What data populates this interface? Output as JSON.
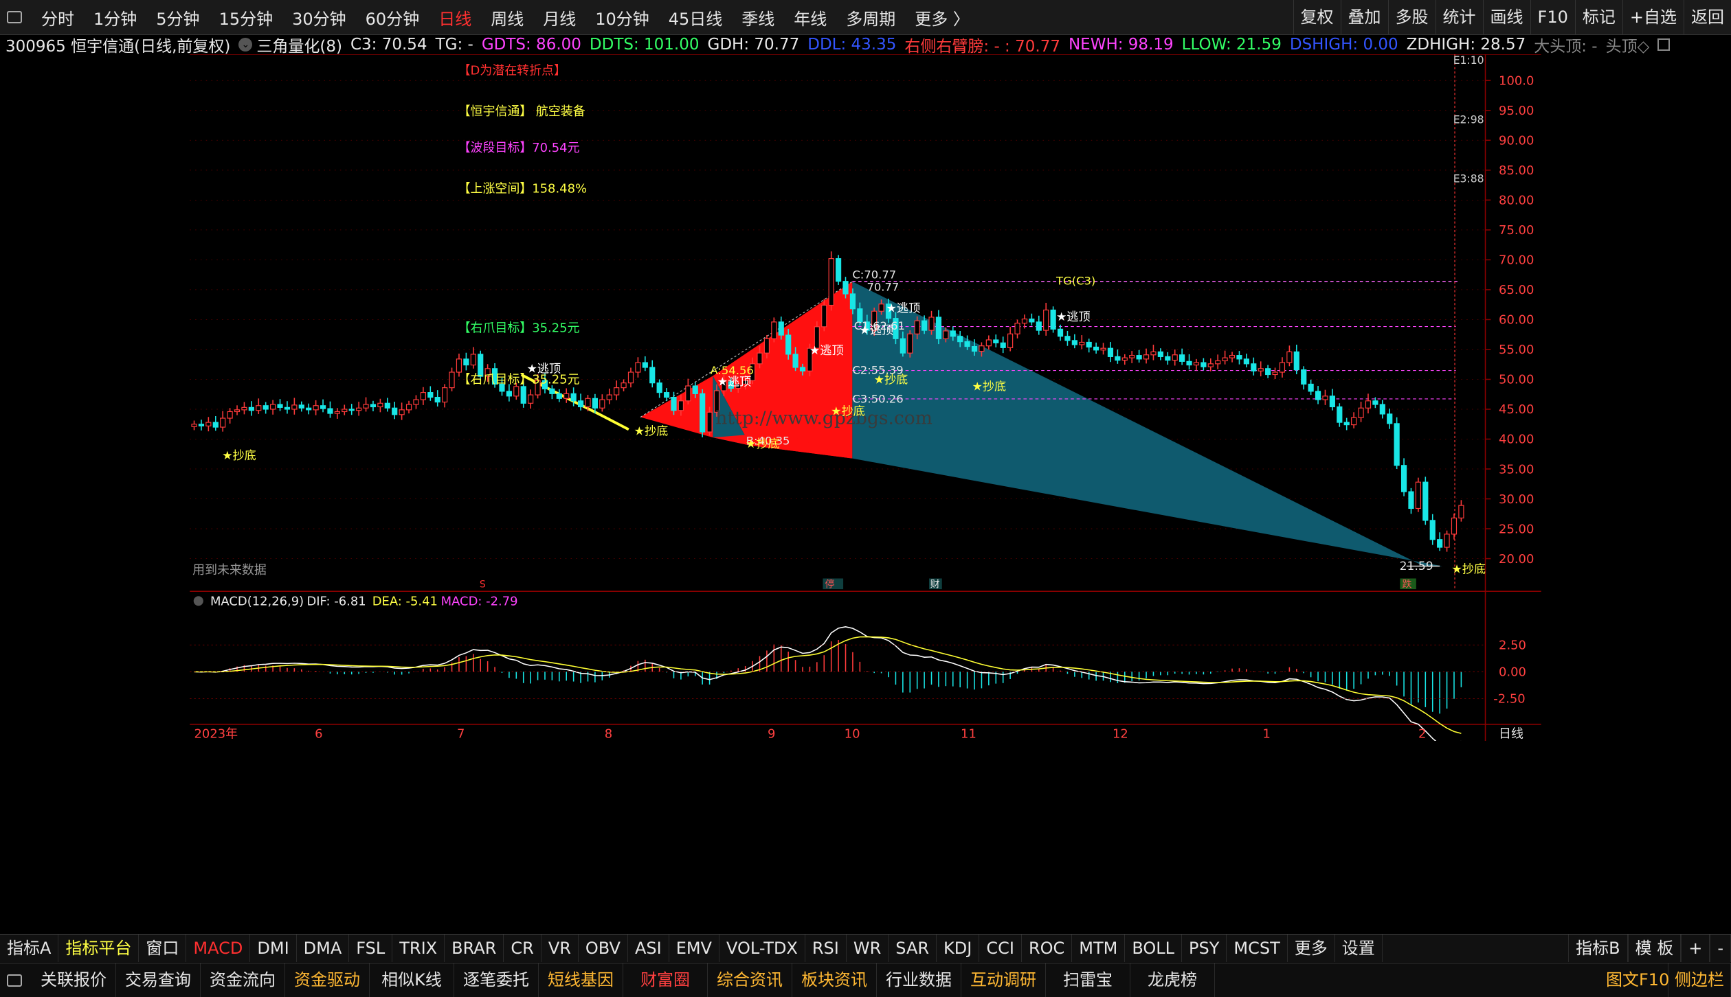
{
  "colors": {
    "up": "#ff3b3b",
    "down": "#19e6e6",
    "yellow": "#ffff44",
    "magenta": "#ff33ff",
    "green": "#33ff66",
    "teal": "#0f5a6e",
    "red_fill": "#ff1010",
    "white": "#ffffff"
  },
  "topbar": {
    "periods": [
      "分时",
      "1分钟",
      "5分钟",
      "15分钟",
      "30分钟",
      "60分钟",
      "日线",
      "周线",
      "月线",
      "10分钟",
      "45日线",
      "季线",
      "年线",
      "多周期",
      "更多 〉"
    ],
    "active_period": "日线",
    "right_buttons": [
      "复权",
      "叠加",
      "多股",
      "统计",
      "画线",
      "F10",
      "标记",
      "+自选",
      "返回"
    ]
  },
  "infobar": {
    "code_name": "300965 恒宇信通(日线,前复权)",
    "indicator_name": "三角量化(8)",
    "c3": "C3: 70.54",
    "tg": "TG: -",
    "gdts": "GDTS: 86.00",
    "ddts": "DDTS: 101.00",
    "gdh": "GDH: 70.77",
    "ddl": "DDL: 43.35",
    "right_arm": "右侧右臂膀: - : 70.77",
    "newh": "NEWH: 98.19",
    "llow": "LLOW: 21.59",
    "dshigh": "DSHIGH: 0.00",
    "zdhigh": "ZDHIGH: 28.57",
    "big_head": "大头顶: -",
    "head_top": "头顶◇"
  },
  "annotations": {
    "d_note": "【D为潜在转折点】",
    "stock_sector": "【恒宇信通】 航空装备",
    "wave_target": "【波段目标】70.54元",
    "up_space": "【上涨空间】158.48%",
    "right_claw_1": "【右爪目标】35.25元",
    "right_claw_2": "【右爪目标】35.25元",
    "future_data": "用到未来数据",
    "watermark": "http://www.gpzbgs.com"
  },
  "chart_labels": {
    "c_label": "C:70.77",
    "c_value": "70.77",
    "a_label": "A:54.56",
    "b_label": "B:40.35",
    "c1_label": "C1:62.61",
    "c2_label": "C2:55.39",
    "c3_label": "C3:50.26",
    "tg_label": "TG(C3)",
    "low_label": "21.59",
    "e1": "E1:10",
    "e2": "E2:98",
    "e3": "E3:88",
    "escape": "★逃顶",
    "buy_bottom": "★抄底",
    "marker_s": "S",
    "marker_stop": "停",
    "marker_fin": "财",
    "marker_drop": "跌"
  },
  "price_axis": [
    "100.0",
    "95.00",
    "90.00",
    "85.00",
    "80.00",
    "75.00",
    "70.00",
    "65.00",
    "60.00",
    "55.00",
    "50.00",
    "45.00",
    "40.00",
    "35.00",
    "30.00",
    "25.00",
    "20.00"
  ],
  "macd": {
    "title": "MACD(12,26,9)",
    "dif": "DIF: -6.81",
    "dea": "DEA: -5.41",
    "macd": "MACD: -2.79",
    "axis": [
      "2.50",
      "0.00",
      "-2.50"
    ]
  },
  "date_axis": {
    "labels": [
      "2023年",
      "6",
      "7",
      "8",
      "9",
      "10",
      "11",
      "12",
      "1",
      "2"
    ],
    "period": "日线"
  },
  "tabs": {
    "items": [
      "指标A",
      "指标平台",
      "窗口",
      "MACD",
      "DMI",
      "DMA",
      "FSL",
      "TRIX",
      "BRAR",
      "CR",
      "VR",
      "OBV",
      "ASI",
      "EMV",
      "VOL-TDX",
      "RSI",
      "WR",
      "SAR",
      "KDJ",
      "CCI",
      "ROC",
      "MTM",
      "BOLL",
      "PSY",
      "MCST",
      "更多",
      "设置"
    ],
    "right": [
      "指标B",
      "模 板",
      "+",
      "-"
    ]
  },
  "bottom": {
    "items": [
      "关联报价",
      "交易查询",
      "资金流向",
      "资金驱动",
      "相似K线",
      "逐笔委托",
      "短线基因",
      "财富圈",
      "综合资讯",
      "板块资讯",
      "行业数据",
      "互动调研",
      "扫雷宝",
      "龙虎榜"
    ],
    "right": [
      "图文F10",
      "侧边栏"
    ]
  },
  "chart_data": {
    "type": "candlestick",
    "price_range": [
      18,
      108
    ],
    "closes": [
      42.5,
      42.2,
      42.8,
      42.0,
      43.5,
      44.6,
      44.9,
      45.3,
      44.8,
      45.6,
      45.0,
      45.8,
      45.3,
      45.0,
      45.7,
      45.2,
      44.9,
      45.6,
      45.1,
      44.3,
      44.6,
      45.0,
      44.8,
      45.2,
      45.8,
      45.4,
      46.0,
      45.2,
      44.1,
      44.9,
      45.8,
      46.6,
      47.8,
      47.0,
      46.2,
      48.6,
      51.2,
      53.4,
      52.4,
      54.2,
      50.5,
      51.8,
      49.2,
      48.0,
      47.2,
      48.8,
      46.0,
      47.4,
      49.8,
      48.4,
      47.6,
      46.8,
      47.6,
      46.4,
      45.4,
      46.8,
      45.2,
      46.6,
      47.4,
      48.6,
      49.4,
      51.2,
      52.8,
      52.0,
      49.4,
      47.8,
      47.0,
      44.8,
      46.4,
      48.9,
      47.6,
      41.2,
      44.5,
      48.1,
      49.6,
      48.5,
      49.2,
      49.8,
      52.6,
      54.4,
      56.8,
      59.6,
      57.4,
      54.2,
      52.0,
      51.4,
      55.2,
      58.8,
      62.4,
      70.2,
      66.4,
      64.3,
      61.8,
      59.6,
      58.2,
      61.4,
      62.6,
      60.2,
      56.8,
      54.4,
      57.6,
      59.8,
      58.2,
      60.4,
      56.8,
      58.1,
      57.2,
      56.3,
      55.5,
      54.7,
      55.6,
      56.6,
      56.1,
      55.3,
      57.6,
      59.4,
      60.1,
      59.6,
      58.2,
      61.6,
      58.4,
      57.2,
      56.5,
      55.8,
      56.2,
      55.4,
      54.9,
      55.2,
      53.8,
      53.2,
      53.6,
      54.0,
      53.4,
      54.1,
      54.6,
      53.8,
      53.2,
      54.1,
      53.0,
      52.4,
      52.8,
      52.1,
      52.6,
      53.1,
      53.6,
      54.0,
      53.4,
      52.6,
      51.4,
      51.8,
      50.8,
      51.2,
      52.8,
      54.6,
      51.6,
      49.2,
      48.0,
      46.6,
      47.2,
      45.4,
      42.8,
      42.4,
      43.6,
      45.2,
      46.4,
      45.8,
      44.2,
      42.6,
      35.6,
      31.2,
      28.4,
      32.8,
      26.4,
      23.2,
      21.9,
      24.1,
      26.8,
      28.9
    ]
  }
}
